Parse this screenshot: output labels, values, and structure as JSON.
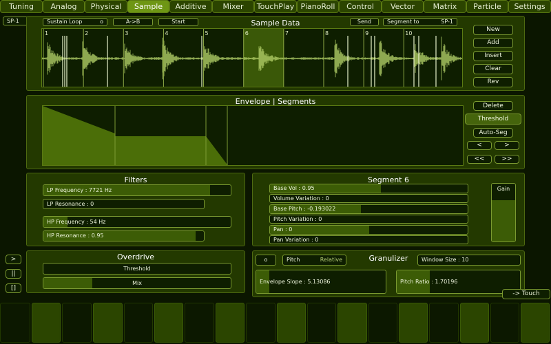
{
  "tabs": [
    "Tuning",
    "Analog",
    "Physical",
    "Sample",
    "Additive",
    "Mixer",
    "TouchPlay",
    "PianoRoll",
    "Control",
    "Vector",
    "Matrix",
    "Particle",
    "Settings"
  ],
  "active_tab": "Sample",
  "sample_id": "SP-1",
  "sample_data": {
    "title": "Sample Data",
    "loop_label": "Sustain Loop",
    "loop_dot": "o",
    "ab_label": "A->B",
    "start_label": "Start",
    "send_label": "Send",
    "segment_to_label": "Segment to",
    "segment_target": "SP-1",
    "segment_markers": [
      "1",
      "2",
      "3",
      "4",
      "5",
      "6",
      "7",
      "8",
      "9",
      "10"
    ],
    "buttons": [
      "New",
      "Add",
      "Insert",
      "Clear",
      "Rev"
    ]
  },
  "envelope": {
    "title": "Envelope | Segments",
    "buttons": {
      "delete": "Delete",
      "threshold": "Threshold",
      "autoseg": "Auto-Seg",
      "prev": "<",
      "next": ">",
      "first": "<<",
      "last": ">>"
    }
  },
  "filters": {
    "title": "Filters",
    "lp_frequency": {
      "label": "LP Frequency : 7721 Hz",
      "level": 0.89
    },
    "lp_resonance": {
      "label": "LP Resonance : 0",
      "level": 0.0
    },
    "hp_frequency": {
      "label": "HP Frequency : 54 Hz",
      "level": 0.13
    },
    "hp_resonance": {
      "label": "HP Resonance : 0.95",
      "level": 0.95
    }
  },
  "segment": {
    "title": "Segment 6",
    "base_vol": {
      "label": "Base Vol : 0.95",
      "level": 0.56
    },
    "volume_variation": {
      "label": "Volume Variation : 0",
      "level": 0.0
    },
    "base_pitch": {
      "label": "Base Pitch : -0.193022",
      "level": 0.46
    },
    "pitch_variation": {
      "label": "Pitch Variation : 0",
      "level": 0.0
    },
    "pan": {
      "label": "Pan : 0",
      "level": 0.5
    },
    "pan_variation": {
      "label": "Pan Variation : 0",
      "level": 0.0
    },
    "gain": {
      "label": "Gain",
      "level": 0.71
    }
  },
  "overdrive": {
    "title": "Overdrive",
    "threshold": {
      "label": "Threshold",
      "level": 0.0
    },
    "mix": {
      "label": "Mix",
      "level": 0.26
    }
  },
  "granulizer": {
    "title": "Granulizer",
    "toggle": "o",
    "pitch_label": "Pitch",
    "pitch_mode": "Relative",
    "window_size": {
      "label": "Window Size : 10",
      "level": 0.0
    },
    "envelope_slope": {
      "label": "Envelope Slope : 5.13086",
      "level": 0.1
    },
    "pitch_ratio": {
      "label": "Pitch Ratio : 1.70196",
      "level": 0.27
    }
  },
  "transport": {
    "play": ">",
    "pause": "||",
    "stop": "[]"
  },
  "touch_button": "-> Touch",
  "colors": {
    "background": "#0b1600",
    "panel": "#233900",
    "accent": "#6e9614",
    "waveform": "#b0cc66",
    "highlight": "#3a5808"
  }
}
